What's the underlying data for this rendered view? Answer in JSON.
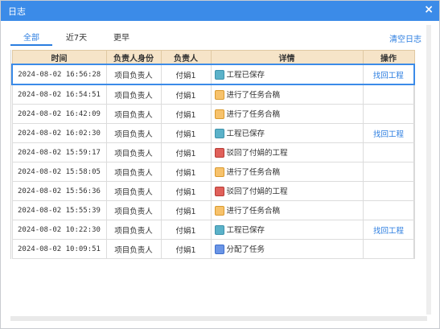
{
  "dialog": {
    "title": "日志",
    "close_glyph": "×"
  },
  "tabs": [
    {
      "label": "全部",
      "active": true
    },
    {
      "label": "近7天",
      "active": false
    },
    {
      "label": "更早",
      "active": false
    }
  ],
  "clear_label": "清空日志",
  "table": {
    "headers": [
      "时间",
      "负责人身份",
      "负责人",
      "详情",
      "操作"
    ],
    "rows": [
      {
        "time": "2024-08-02 16:56:28",
        "role": "项目负责人",
        "person": "付娟1",
        "detail": "工程已保存",
        "icon": "save-icon",
        "action": "找回工程"
      },
      {
        "time": "2024-08-02 16:54:51",
        "role": "项目负责人",
        "person": "付娟1",
        "detail": "进行了任务合稿",
        "icon": "commit-icon",
        "action": ""
      },
      {
        "time": "2024-08-02 16:42:09",
        "role": "项目负责人",
        "person": "付娟1",
        "detail": "进行了任务合稿",
        "icon": "commit-icon",
        "action": ""
      },
      {
        "time": "2024-08-02 16:02:30",
        "role": "项目负责人",
        "person": "付娟1",
        "detail": "工程已保存",
        "icon": "save-icon",
        "action": "找回工程"
      },
      {
        "time": "2024-08-02 15:59:17",
        "role": "项目负责人",
        "person": "付娟1",
        "detail": "驳回了付娟的工程",
        "icon": "reject-icon",
        "action": ""
      },
      {
        "time": "2024-08-02 15:58:05",
        "role": "项目负责人",
        "person": "付娟1",
        "detail": "进行了任务合稿",
        "icon": "commit-icon",
        "action": ""
      },
      {
        "time": "2024-08-02 15:56:36",
        "role": "项目负责人",
        "person": "付娟1",
        "detail": "驳回了付娟的工程",
        "icon": "reject-icon",
        "action": ""
      },
      {
        "time": "2024-08-02 15:55:39",
        "role": "项目负责人",
        "person": "付娟1",
        "detail": "进行了任务合稿",
        "icon": "commit-icon",
        "action": ""
      },
      {
        "time": "2024-08-02 10:22:30",
        "role": "项目负责人",
        "person": "付娟1",
        "detail": "工程已保存",
        "icon": "save-icon",
        "action": "找回工程"
      },
      {
        "time": "2024-08-02 10:09:51",
        "role": "项目负责人",
        "person": "付娟1",
        "detail": "分配了任务",
        "icon": "assign-icon",
        "action": ""
      }
    ]
  },
  "colors": {
    "titlebar": "#3b8be8",
    "header_bg": "#f6e4c8",
    "link": "#2b7de0",
    "selected_border": "#3b8be8"
  }
}
